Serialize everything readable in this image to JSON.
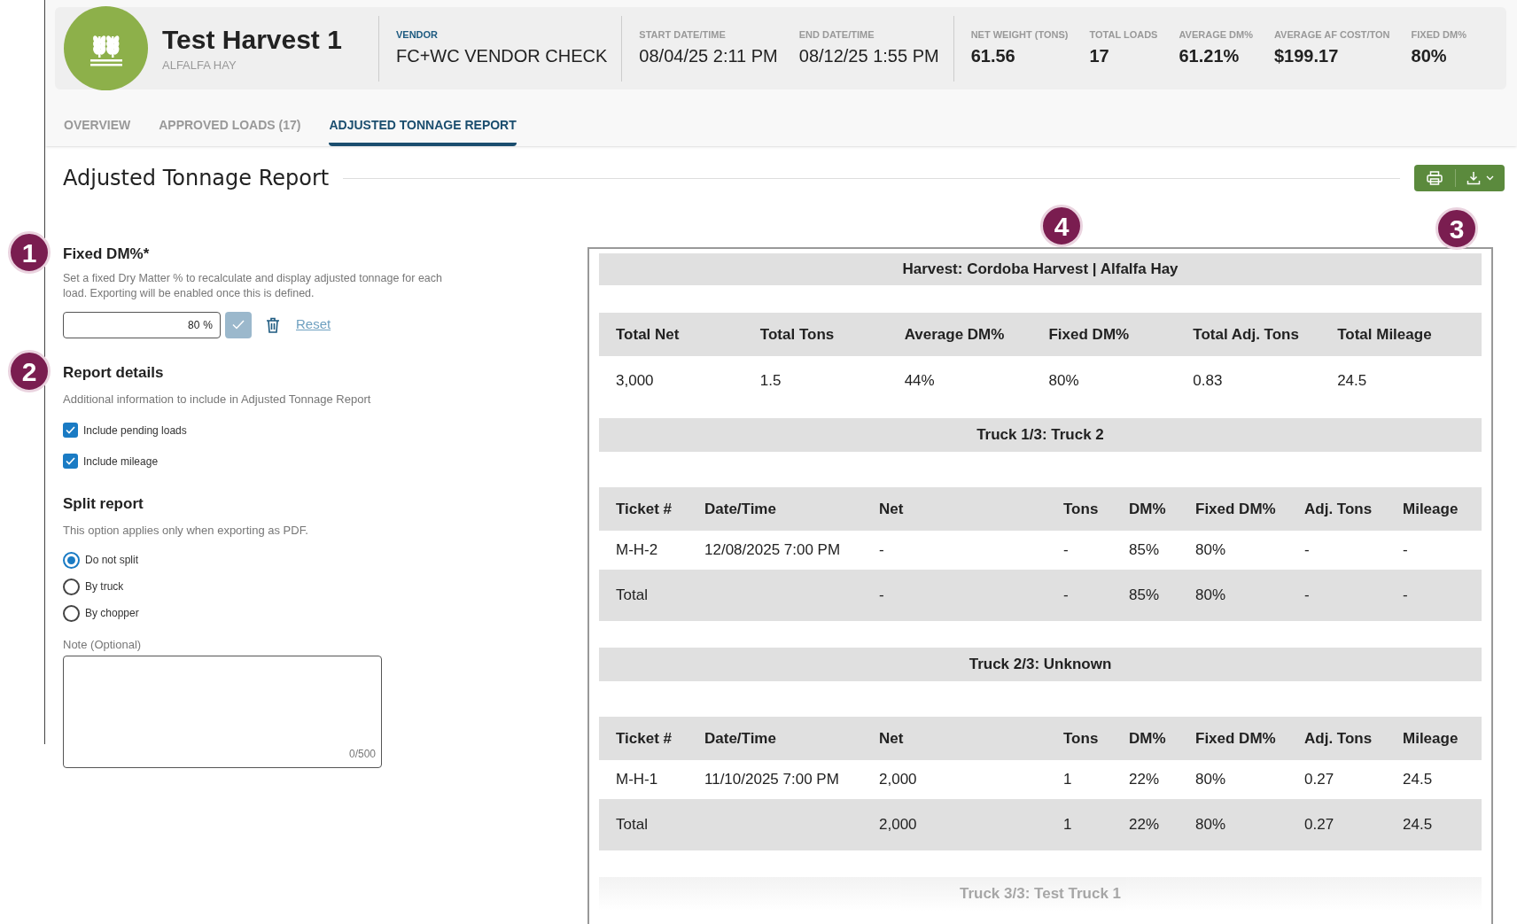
{
  "header": {
    "title": "Test Harvest 1",
    "subtitle": "ALFALFA HAY",
    "groups": [
      [
        {
          "label": "VENDOR",
          "value": "FC+WC VENDOR CHECK",
          "kind": "vendor"
        }
      ],
      [
        {
          "label": "START DATE/TIME",
          "value": "08/04/25 2:11 PM",
          "kind": "date"
        },
        {
          "label": "END DATE/TIME",
          "value": "08/12/25 1:55 PM",
          "kind": "date"
        }
      ],
      [
        {
          "label": "NET WEIGHT (TONS)",
          "value": "61.56",
          "kind": "metric"
        },
        {
          "label": "TOTAL LOADS",
          "value": "17",
          "kind": "metric"
        },
        {
          "label": "AVERAGE DM%",
          "value": "61.21%",
          "kind": "metric"
        },
        {
          "label": "AVERAGE AF COST/TON",
          "value": "$199.17",
          "kind": "metric"
        },
        {
          "label": "FIXED DM%",
          "value": "80%",
          "kind": "metric"
        }
      ]
    ]
  },
  "tabs": [
    {
      "label": "OVERVIEW",
      "selected": false
    },
    {
      "label": "APPROVED LOADS (17)",
      "selected": false
    },
    {
      "label": "ADJUSTED TONNAGE REPORT",
      "selected": true
    }
  ],
  "section_title": "Adjusted Tonnage Report",
  "fixed_dm": {
    "title": "Fixed DM%*",
    "description": "Set a fixed Dry Matter % to recalculate and display adjusted tonnage for each load. Exporting will be enabled once this is defined.",
    "value": "80",
    "unit": "%",
    "reset": "Reset"
  },
  "report_details": {
    "title": "Report details",
    "description": "Additional information to include in Adjusted Tonnage Report",
    "checkboxes": [
      {
        "label": "Include pending loads",
        "checked": true
      },
      {
        "label": "Include mileage",
        "checked": true
      }
    ]
  },
  "split_report": {
    "title": "Split report",
    "description": "This option applies only when exporting as PDF.",
    "options": [
      {
        "label": "Do not split",
        "selected": true
      },
      {
        "label": "By truck",
        "selected": false
      },
      {
        "label": "By chopper",
        "selected": false
      }
    ]
  },
  "note": {
    "label": "Note (Optional)",
    "counter": "0/500"
  },
  "callouts": [
    "1",
    "2",
    "3",
    "4"
  ],
  "report": {
    "title": "Harvest: Cordoba Harvest | Alfalfa Hay",
    "summary": {
      "columns": [
        "Total Net",
        "Total Tons",
        "Average DM%",
        "Fixed DM%",
        "Total Adj. Tons",
        "Total Mileage"
      ],
      "values": [
        "3,000",
        "1.5",
        "44%",
        "80%",
        "0.83",
        "24.5"
      ]
    },
    "trucks": [
      {
        "title": "Truck 1/3: Truck 2",
        "faded": false,
        "columns": [
          "Ticket #",
          "Date/Time",
          "Net",
          "Tons",
          "DM%",
          "Fixed DM%",
          "Adj. Tons",
          "Mileage"
        ],
        "rows": [
          {
            "kind": "load",
            "cells": [
              "M-H-2",
              "12/08/2025 7:00 PM",
              "-",
              "-",
              "85%",
              "80%",
              "-",
              "-"
            ]
          },
          {
            "kind": "total",
            "cells": [
              "Total",
              "",
              "-",
              "-",
              "85%",
              "80%",
              "-",
              "-"
            ]
          }
        ]
      },
      {
        "title": "Truck 2/3: Unknown",
        "faded": false,
        "columns": [
          "Ticket #",
          "Date/Time",
          "Net",
          "Tons",
          "DM%",
          "Fixed DM%",
          "Adj. Tons",
          "Mileage"
        ],
        "rows": [
          {
            "kind": "load",
            "cells": [
              "M-H-1",
              "11/10/2025 7:00 PM",
              "2,000",
              "1",
              "22%",
              "80%",
              "0.27",
              "24.5"
            ]
          },
          {
            "kind": "total",
            "cells": [
              "Total",
              "",
              "2,000",
              "1",
              "22%",
              "80%",
              "0.27",
              "24.5"
            ]
          }
        ]
      },
      {
        "title": "Truck 3/3: Test Truck 1",
        "faded": true
      }
    ]
  }
}
